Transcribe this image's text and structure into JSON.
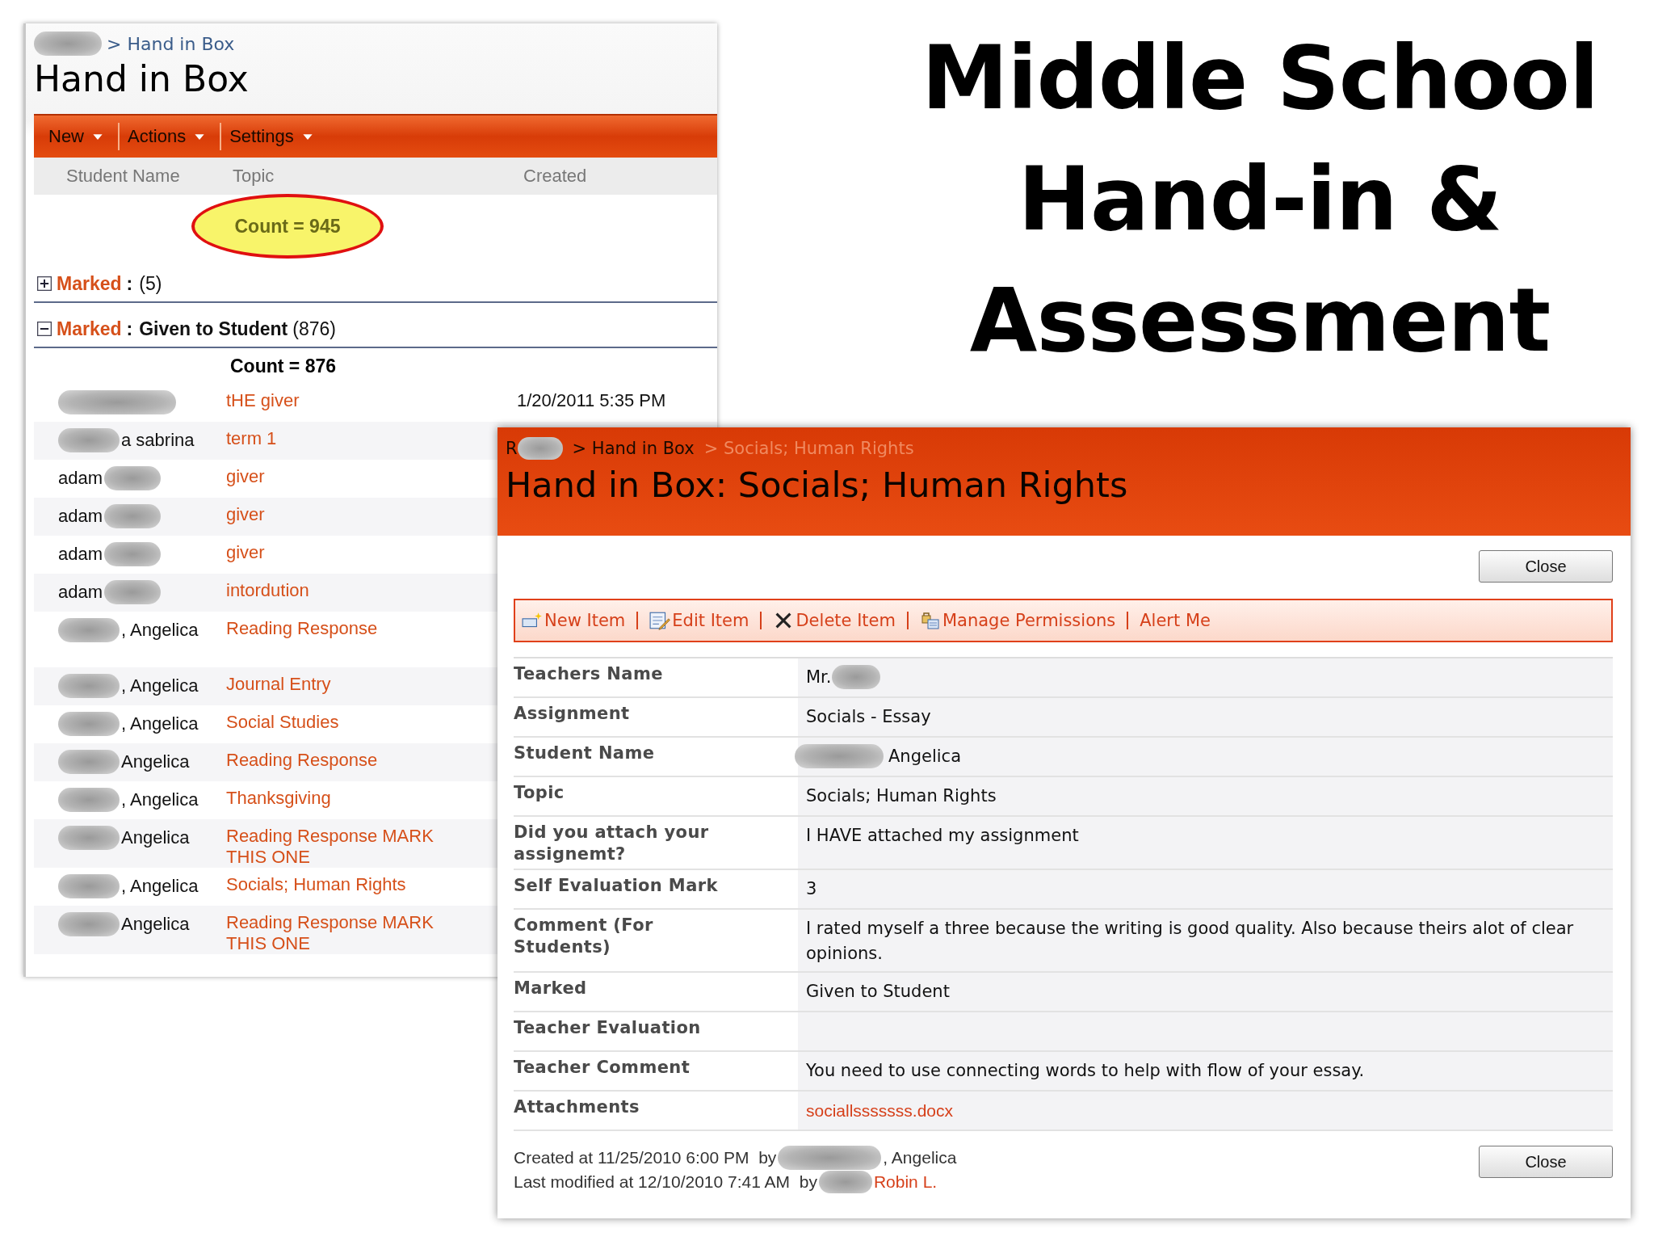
{
  "slide_title": [
    "Middle School",
    "Hand-in &",
    "Assessment"
  ],
  "list_window": {
    "breadcrumb": {
      "blur_before": true,
      "text": "> Hand in Box"
    },
    "title": "Hand in Box",
    "menus": [
      {
        "label": "New"
      },
      {
        "label": "Actions"
      },
      {
        "label": "Settings"
      }
    ],
    "columns": [
      "Student Name",
      "Topic",
      "Created"
    ],
    "total_count": {
      "text": "Count = 945",
      "highlighted": true
    },
    "groups": [
      {
        "expanded": false,
        "field": "Marked",
        "separator": ":",
        "count": "(5)"
      },
      {
        "expanded": true,
        "field": "Marked",
        "separator": ":",
        "value": "Given to Student",
        "count": "(876)",
        "count_label": "Count = 876",
        "rows": [
          {
            "blur_before": true,
            "topic": "tHE giver",
            "created": "1/20/2011 5:35 PM"
          },
          {
            "blur_before": true,
            "name": "a sabrina",
            "topic": "term 1"
          },
          {
            "blur_after": true,
            "name": "adam",
            "topic": "giver"
          },
          {
            "blur_after": true,
            "name": "adam",
            "topic": "giver"
          },
          {
            "blur_after": true,
            "name": "adam",
            "topic": "giver"
          },
          {
            "blur_after": true,
            "name": "adam",
            "topic": "intordution"
          },
          {
            "blur_before": true,
            "name": ", Angelica",
            "topic": "Reading Response",
            "tall": true
          },
          {
            "blur_before": true,
            "name": ", Angelica",
            "topic": "Journal Entry"
          },
          {
            "blur_before": true,
            "name": ", Angelica",
            "topic": "Social Studies"
          },
          {
            "blur_before": true,
            "name": "Angelica",
            "topic": "Reading Response"
          },
          {
            "blur_before": true,
            "name": ", Angelica",
            "topic": "Thanksgiving"
          },
          {
            "blur_before": true,
            "name": "Angelica",
            "topic": "Reading Response MARK THIS ONE"
          },
          {
            "blur_before": true,
            "name": ", Angelica",
            "topic": "Socials; Human Rights"
          },
          {
            "blur_before": true,
            "name": "Angelica",
            "topic": "Reading Response MARK THIS ONE"
          }
        ]
      }
    ]
  },
  "dialog": {
    "breadcrumb": [
      {
        "text": "R",
        "blur_after": true,
        "current": false
      },
      {
        "text": "> Hand in Box",
        "current": false
      },
      {
        "text": "> Socials; Human Rights",
        "current": true
      }
    ],
    "title": "Hand in Box: Socials; Human Rights",
    "close_top": "Close",
    "actions": [
      {
        "kind": "new",
        "label": "New Item"
      },
      {
        "kind": "edit",
        "label": "Edit Item"
      },
      {
        "kind": "delete",
        "label": "Delete Item"
      },
      {
        "kind": "permissions",
        "label": "Manage Permissions"
      },
      {
        "kind": "plain",
        "label": "Alert Me"
      }
    ],
    "fields": [
      {
        "label": "Teachers Name",
        "value": "Mr.",
        "blur_after": true
      },
      {
        "label": "Assignment",
        "value": "Socials - Essay"
      },
      {
        "label": "Student Name",
        "value": "Angelica",
        "blur_before": true
      },
      {
        "label": "Topic",
        "value": "Socials; Human Rights"
      },
      {
        "label": "Did you attach your assignemt?",
        "value": "I HAVE attached my assignment"
      },
      {
        "label": "Self Evaluation Mark",
        "value": "3"
      },
      {
        "label": "Comment (For Students)",
        "value": "I rated myself a three because the writing is good quality. Also because theirs alot of clear opinions."
      },
      {
        "label": "Marked",
        "value": "Given to Student"
      },
      {
        "label": "Teacher Evaluation"
      },
      {
        "label": "Teacher Comment",
        "value": "You need to use connecting words to help with flow of your essay."
      },
      {
        "label": "Attachments",
        "value": "sociallsssssss.docx",
        "link": true
      }
    ],
    "footer": [
      {
        "prefix": "Created at 11/25/2010 6:00 PM  by",
        "name": ", Angelica",
        "link": false
      },
      {
        "prefix": "Last modified at 12/10/2010 7:41 AM  by",
        "name": "Robin L.",
        "link": true
      }
    ],
    "close_bottom": "Close"
  }
}
